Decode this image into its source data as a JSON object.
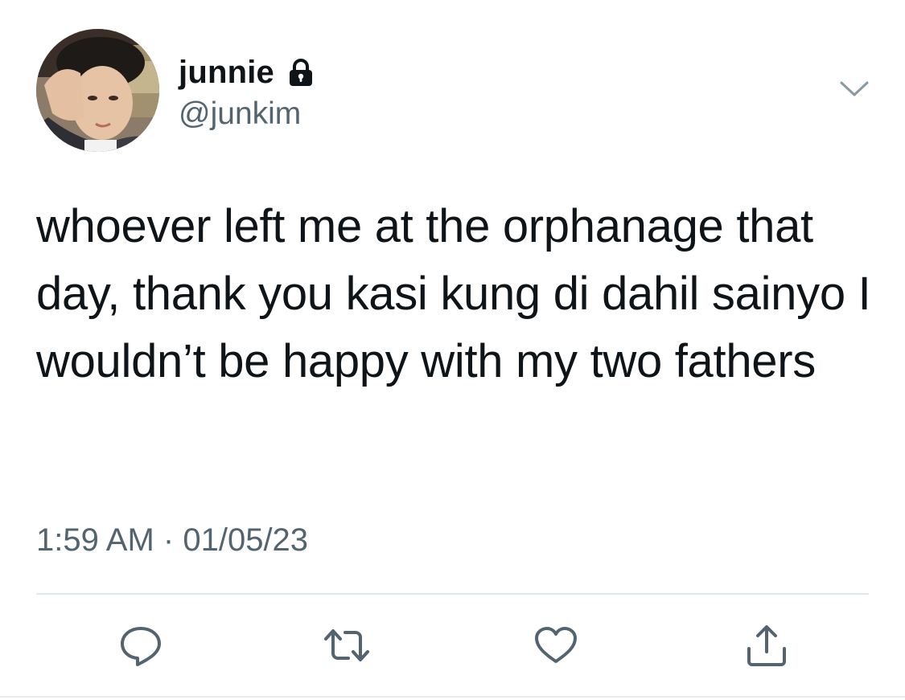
{
  "tweet": {
    "author": {
      "display_name": "junnie",
      "handle": "@junkim",
      "protected_icon": "lock-icon",
      "avatar": "profile-photo"
    },
    "menu_icon": "chevron-down-icon",
    "text": "whoever left me at the orphanage that day, thank you kasi kung di dahil sainyo I wouldn’t be happy with my two fathers",
    "time": "1:59 AM",
    "separator": "·",
    "date": "01/05/23"
  },
  "actions": [
    {
      "name": "reply",
      "icon": "reply-icon"
    },
    {
      "name": "retweet",
      "icon": "retweet-icon"
    },
    {
      "name": "like",
      "icon": "heart-icon"
    },
    {
      "name": "share",
      "icon": "share-icon"
    }
  ],
  "colors": {
    "text_primary": "#0f1419",
    "text_secondary": "#536471",
    "divider": "#e1e8ed",
    "icon": "#536471"
  }
}
